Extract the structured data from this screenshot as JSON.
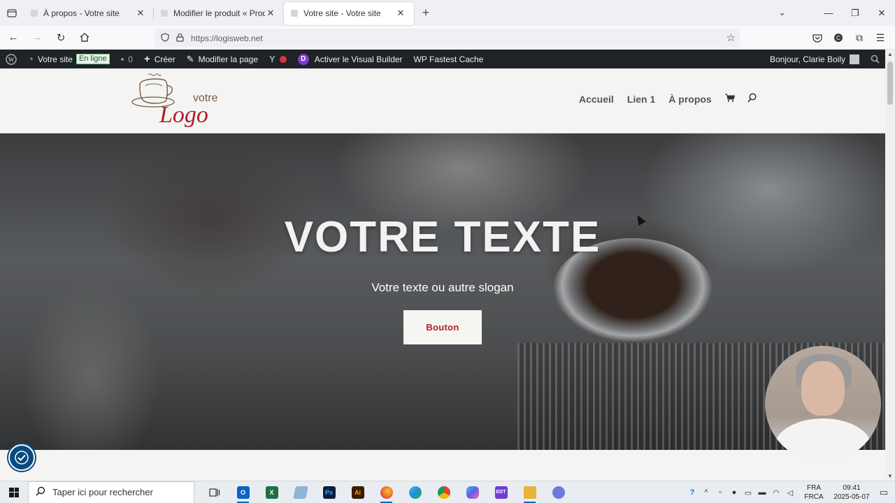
{
  "browser": {
    "tabs": [
      {
        "title": "À propos - Votre site",
        "active": false
      },
      {
        "title": "Modifier le produit « Produit ex",
        "active": false
      },
      {
        "title": "Votre site - Votre site",
        "active": true
      }
    ],
    "url": "https://logisweb.net"
  },
  "admin_bar": {
    "site_name": "Votre site",
    "status_badge": "En ligne",
    "comments_count": "0",
    "create_label": "Créer",
    "edit_page_label": "Modifier la page",
    "visual_builder_label": "Activer le Visual Builder",
    "fastest_cache_label": "WP Fastest Cache",
    "greeting": "Bonjour, Clarie Boily",
    "divi_letter": "D"
  },
  "site": {
    "logo": {
      "word1": "votre",
      "word2": "Logo"
    },
    "menu": [
      "Accueil",
      "Lien 1",
      "À propos"
    ],
    "brand_color": "#b01e2a"
  },
  "hero": {
    "title": "VOTRE TEXTE",
    "subtitle": "Votre texte ou autre slogan",
    "button": "Bouton"
  },
  "taskbar": {
    "search_placeholder": "Taper ici pour rechercher",
    "lang_line1": "FRA",
    "lang_line2": "FRCA",
    "time": "09:41",
    "date": "2025-05-07",
    "apps": [
      {
        "name": "outlook",
        "label": "O",
        "color": "#0a64c8"
      },
      {
        "name": "excel",
        "label": "X",
        "color": "#1d7044"
      },
      {
        "name": "notes",
        "label": "",
        "color": "#8fb3d9"
      },
      {
        "name": "photoshop",
        "label": "Ps",
        "color": "#0b1f3a"
      },
      {
        "name": "illustrator",
        "label": "Ai",
        "color": "#3a1b00"
      },
      {
        "name": "firefox",
        "label": "",
        "color": "#e8622a"
      },
      {
        "name": "edge",
        "label": "",
        "color": "#1f8fd6"
      },
      {
        "name": "chrome",
        "label": "",
        "color": "#2b9a4b"
      },
      {
        "name": "copilot",
        "label": "",
        "color": "#6a5be3"
      },
      {
        "name": "edt",
        "label": "EDT",
        "color": "#6e3bd6"
      },
      {
        "name": "file-explorer",
        "label": "",
        "color": "#e7b43a"
      },
      {
        "name": "settings-app",
        "label": "",
        "color": "#6b7bd8"
      }
    ]
  }
}
